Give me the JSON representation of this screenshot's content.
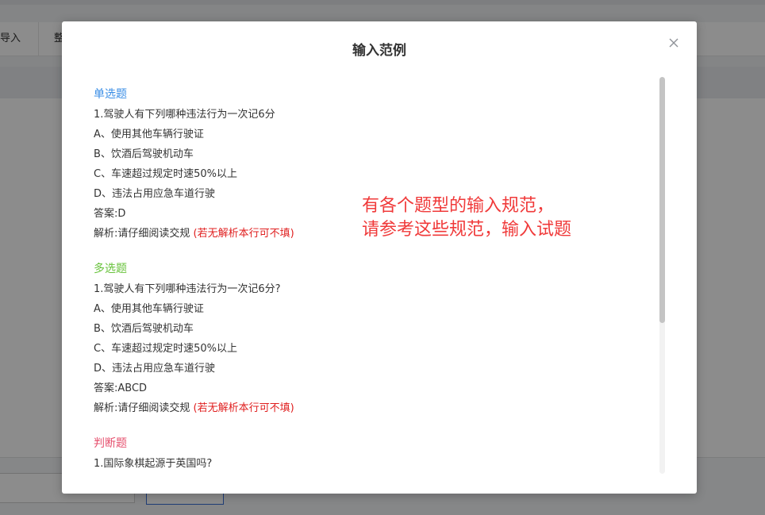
{
  "background": {
    "toolbar_tabs": [
      "导入",
      "整"
    ]
  },
  "modal": {
    "title": "输入范例",
    "close_icon": "close-icon",
    "annotation_lines": [
      "有各个题型的输入规范，",
      "请参考这些规范，输入试题"
    ],
    "sections": [
      {
        "heading": "单选题",
        "heading_color": "#3a8ee6",
        "question": "1.驾驶人有下列哪种违法行为一次记6分",
        "options": [
          "A、使用其他车辆行驶证",
          "B、饮酒后驾驶机动车",
          "C、车速超过规定时速50%以上",
          "D、违法占用应急车道行驶"
        ],
        "answer": "答案:D",
        "analysis": "解析:请仔细阅读交规",
        "analysis_note": "(若无解析本行可不填)"
      },
      {
        "heading": "多选题",
        "heading_color": "#67c23a",
        "question": "1.驾驶人有下列哪种违法行为一次记6分?",
        "options": [
          "A、使用其他车辆行驶证",
          "B、饮酒后驾驶机动车",
          "C、车速超过规定时速50%以上",
          "D、违法占用应急车道行驶"
        ],
        "answer": "答案:ABCD",
        "analysis": "解析:请仔细阅读交规",
        "analysis_note": "(若无解析本行可不填)"
      },
      {
        "heading": "判断题",
        "heading_color": "#e6506e",
        "question": "1.国际象棋起源于英国吗?"
      }
    ]
  },
  "colors": {
    "note_red": "#e02020",
    "annotation_red": "#f03a3a"
  }
}
